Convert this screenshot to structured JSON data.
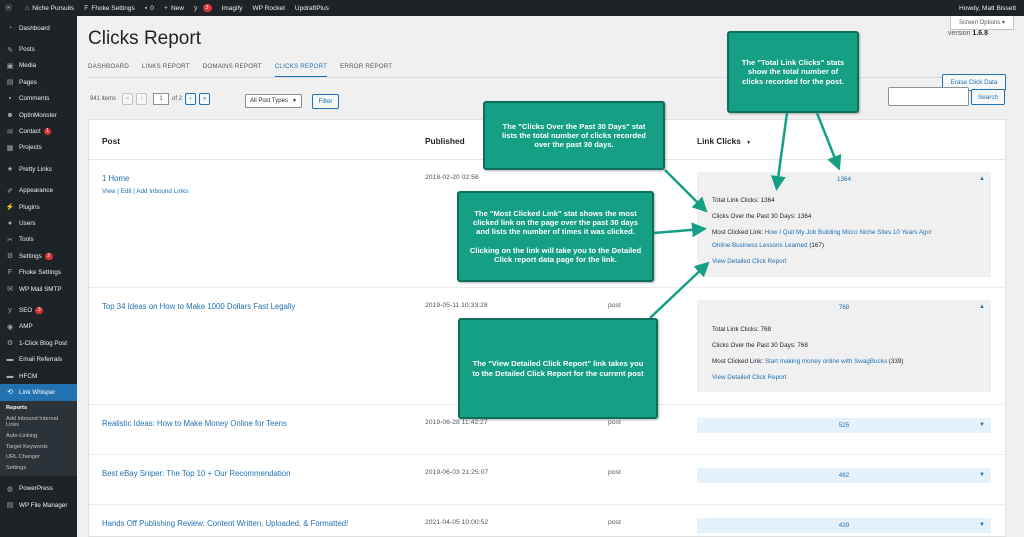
{
  "adminbar": {
    "site": "Niche Pursuits",
    "fhoke": "Fhoke Settings",
    "comments_count": "0",
    "new": "New",
    "updates_count": "3",
    "imagify": "Imagify",
    "rocket": "WP Rocket",
    "updraft": "UpdraftPlus",
    "howdy": "Howdy, Matt Bissett"
  },
  "sidebar": {
    "items": [
      {
        "label": "Dashboard",
        "icon": "dashboard-icon"
      },
      {
        "label": "Posts",
        "icon": "pin-icon"
      },
      {
        "label": "Media",
        "icon": "media-icon"
      },
      {
        "label": "Pages",
        "icon": "page-icon"
      },
      {
        "label": "Comments",
        "icon": "comment-icon"
      },
      {
        "label": "OptinMonster",
        "icon": "monster-icon"
      },
      {
        "label": "Contact",
        "icon": "mail-icon",
        "badge": "1"
      },
      {
        "label": "Projects",
        "icon": "folder-icon"
      },
      {
        "label": "Pretty Links",
        "icon": "link-icon"
      },
      {
        "label": "Appearance",
        "icon": "brush-icon"
      },
      {
        "label": "Plugins",
        "icon": "plugin-icon"
      },
      {
        "label": "Users",
        "icon": "user-icon"
      },
      {
        "label": "Tools",
        "icon": "wrench-icon"
      },
      {
        "label": "Settings",
        "icon": "settings-icon",
        "badge": "2"
      },
      {
        "label": "Fhoke Settings",
        "icon": "fhoke-icon"
      },
      {
        "label": "WP Mail SMTP",
        "icon": "smtp-icon"
      },
      {
        "label": "SEO",
        "icon": "seo-icon",
        "badge": "3"
      },
      {
        "label": "AMP",
        "icon": "amp-icon"
      },
      {
        "label": "1-Click Blog Post",
        "icon": "gear-icon"
      },
      {
        "label": "Email Referrals",
        "icon": "email-icon"
      },
      {
        "label": "HFCM",
        "icon": "code-icon"
      },
      {
        "label": "Link Whisper",
        "icon": "whisper-icon"
      }
    ],
    "submenu": [
      "Reports",
      "Add Inbound Internal Links",
      "Auto-Linking",
      "Target Keywords",
      "URL Changer",
      "Settings"
    ],
    "after": [
      {
        "label": "PowerPress",
        "icon": "mic-icon"
      },
      {
        "label": "WP File Manager",
        "icon": "file-icon"
      }
    ]
  },
  "screen_options": "Screen Options ▾",
  "page_title": "Clicks Report",
  "version_label": "version",
  "version_number": "1.6.8",
  "tabs": [
    "DASHBOARD",
    "LINKS REPORT",
    "DOMAINS REPORT",
    "CLICKS REPORT",
    "ERROR REPORT"
  ],
  "erase_button": "Erase Click Data",
  "pager": {
    "items": "941 items",
    "first": "«",
    "prev": "‹",
    "current": "1",
    "of": "of 2",
    "next": "›",
    "last": "»"
  },
  "post_type_select": "All Post Types",
  "filter_button": "Filter",
  "search_button": "Search",
  "table": {
    "col_post": "Post",
    "col_published": "Published",
    "col_clicks": "Link Clicks",
    "sort_indicator": "▼",
    "rows": [
      {
        "title": "1 Home",
        "actions": "View | Edit | Add Inbound Links",
        "date": "2018-02-20 02:58",
        "type": "",
        "clicks": "1364",
        "expanded": true,
        "total_label": "Total Link Clicks:",
        "total": "1364",
        "past30_label": "Clicks Over the Past 30 Days:",
        "past30": "1364",
        "most_label": "Most Clicked Link:",
        "most_link_1": "How I Quit My Job Building Micro Niche Sites 10 Years Ago!",
        "most_link_2": "Online Business Lessons Learned",
        "most_count": "(167)",
        "view_report": "View Detailed Click Report"
      },
      {
        "title": "Top 34 Ideas on How to Make 1000 Dollars Fast Legally",
        "date": "2019-05-11 10:33:28",
        "type": "post",
        "clicks": "768",
        "expanded": true,
        "total_label": "Total Link Clicks:",
        "total": "768",
        "past30_label": "Clicks Over the Past 30 Days:",
        "past30": "768",
        "most_label": "Most Clicked Link:",
        "most_link_1": "Start making money online with SwagBucks",
        "most_count": "(339)",
        "view_report": "View Detailed Click Report"
      },
      {
        "title": "Realistic Ideas: How to Make Money Online for Teens",
        "date": "2019-06-28 11:42:27",
        "type": "post",
        "clicks": "525"
      },
      {
        "title": "Best eBay Sniper: The Top 10 + Our Recommendation",
        "date": "2019-06-03 21:25:07",
        "type": "post",
        "clicks": "482"
      },
      {
        "title": "Hands Off Publishing Review: Content Written, Uploaded, & Formatted!",
        "date": "2021-04-05 10:00:52",
        "type": "post",
        "clicks": "439"
      }
    ]
  },
  "callouts": {
    "total": "The \"Total Link Clicks\" stats show the total number of clicks recorded for the post.",
    "past30": "The \"Clicks Over the Past 30 Days\" stat lists the total number of clicks recorded over the past 30 days.",
    "most_1": "The \"Most Clicked Link\" stat shows the most clicked link on the page over the past 30 days and lists the number of times it was clicked.",
    "most_2": "Clicking on the link will take you to the Detailed Click report data page for the link.",
    "view": "The \"View Detailed Click Report\" link takes you to the Detailed Click Report for the current post"
  },
  "colors": {
    "accent": "#2271b1",
    "callout": "#15a086",
    "admin_dark": "#1d2327"
  }
}
